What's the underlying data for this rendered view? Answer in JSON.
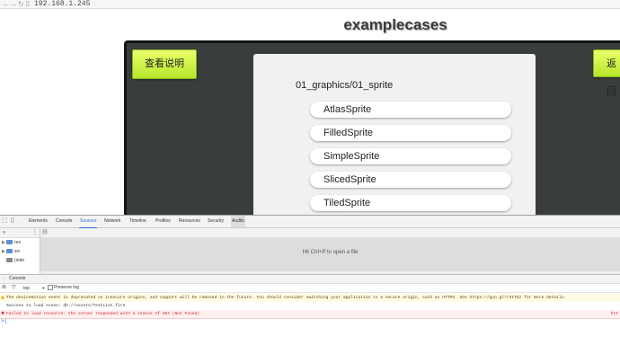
{
  "browser": {
    "url": "192.168.1.245",
    "back_glyph": "←",
    "forward_glyph": "→",
    "reload_glyph": "↻",
    "doc_glyph": "▯"
  },
  "page": {
    "title": "examplecases",
    "left_button": "查看说明",
    "right_button": "返回",
    "panel_heading": "01_graphics/01_sprite",
    "items": [
      {
        "label": "AtlasSprite"
      },
      {
        "label": "FilledSprite"
      },
      {
        "label": "SimpleSprite"
      },
      {
        "label": "SlicedSprite"
      },
      {
        "label": "TiledSprite"
      }
    ]
  },
  "devtools": {
    "inspect_glyph": "⬚",
    "device_glyph": "▯",
    "tabs": [
      {
        "label": "Elements"
      },
      {
        "label": "Console"
      },
      {
        "label": "Sources"
      },
      {
        "label": "Network"
      },
      {
        "label": "Timeline"
      },
      {
        "label": "Profiles"
      },
      {
        "label": "Resources"
      },
      {
        "label": "Security"
      },
      {
        "label": "Audits"
      }
    ],
    "sidebar_more": "»",
    "sidebar_glyph": "⋮",
    "tree": [
      {
        "label": "res"
      },
      {
        "label": "src"
      },
      {
        "label": "(inde"
      }
    ],
    "editor_toggle": "⊟",
    "editor_hint": "Hit Ctrl+P to open a file",
    "drawer": {
      "close_glyph": "⋮",
      "tab": "Console",
      "clear_glyph": "⊘",
      "filter_glyph": "▽",
      "context": "top",
      "context_arrow": "▼",
      "preserve_log": "Preserve log"
    },
    "messages": [
      {
        "level": "warn",
        "icon": "▲",
        "text": "The devicemotion event is deprecated on insecure origins, and support will be removed in the future. You should consider switching your application to a secure origin, such as HTTPS. See https://goo.gl/rStTGz for more details.",
        "source": ""
      },
      {
        "level": "info",
        "icon": "",
        "text": "Success to load scene: db://assets/TestList.fire",
        "source": ""
      },
      {
        "level": "err",
        "icon": "✖",
        "text": "Failed to load resource: the server responded with a status of 404 (Not Found)",
        "source": "htt"
      }
    ],
    "prompt": ">|"
  },
  "colors": {
    "button_yellow": "#d4f54a",
    "canvas_bg": "#3a3d3d",
    "active_tab": "#2f6fd0",
    "error_text": "#d02020"
  }
}
